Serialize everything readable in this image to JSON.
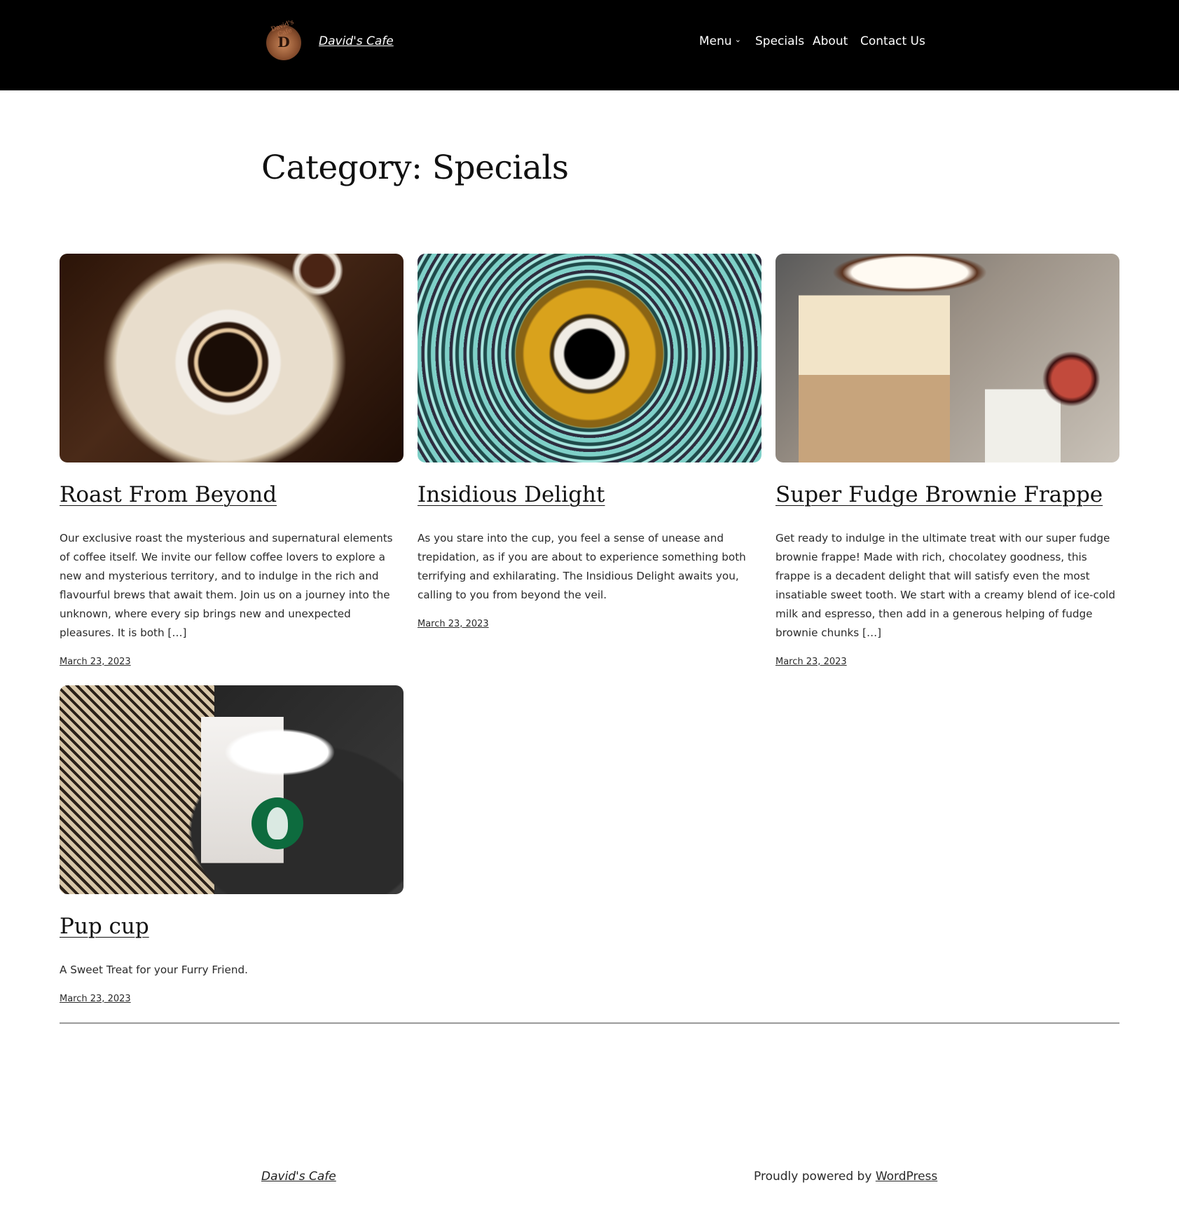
{
  "header": {
    "site_title": "David's Cafe",
    "logo_letter": "D",
    "logo_arc_text": "David's Cafe",
    "nav": {
      "menu": "Menu",
      "menu_chevron": "⌄",
      "specials": "Specials",
      "about": "About",
      "contact": "Contact Us"
    }
  },
  "archive_title": "Category: Specials",
  "posts": [
    {
      "title": "Roast From Beyond",
      "excerpt": "Our exclusive roast the mysterious and supernatural elements of coffee itself. We invite our fellow coffee lovers to explore a new and mysterious territory, and to indulge in the rich and flavourful brews that await them. Join us on a journey into the unknown, where every sip brings new and unexpected pleasures. It is both […]",
      "date": "March 23, 2023"
    },
    {
      "title": "Insidious Delight",
      "excerpt": "As you stare into the cup, you feel a sense of unease and trepidation, as if you are about to experience something both terrifying and exhilarating. The Insidious Delight awaits you, calling to you from beyond the veil.",
      "date": "March 23, 2023"
    },
    {
      "title": "Super Fudge Brownie Frappe",
      "excerpt": "Get ready to indulge in the ultimate treat with our super fudge brownie frappe! Made with rich, chocolatey goodness, this frappe is a decadent delight that will satisfy even the most insatiable sweet tooth. We start with a creamy blend of ice-cold milk and espresso, then add in a generous helping of fudge brownie chunks […]",
      "date": "March 23, 2023"
    },
    {
      "title": "Pup cup",
      "excerpt": "A Sweet Treat for your Furry Friend.",
      "date": "March 23, 2023"
    }
  ],
  "footer": {
    "site_title": "David's Cafe",
    "powered_prefix": "Proudly powered by ",
    "powered_link": "WordPress"
  },
  "colors": {
    "header_bg": "#000000",
    "page_bg": "#ffffff",
    "text": "#1e1e1e",
    "divider": "#9a9a9a"
  }
}
